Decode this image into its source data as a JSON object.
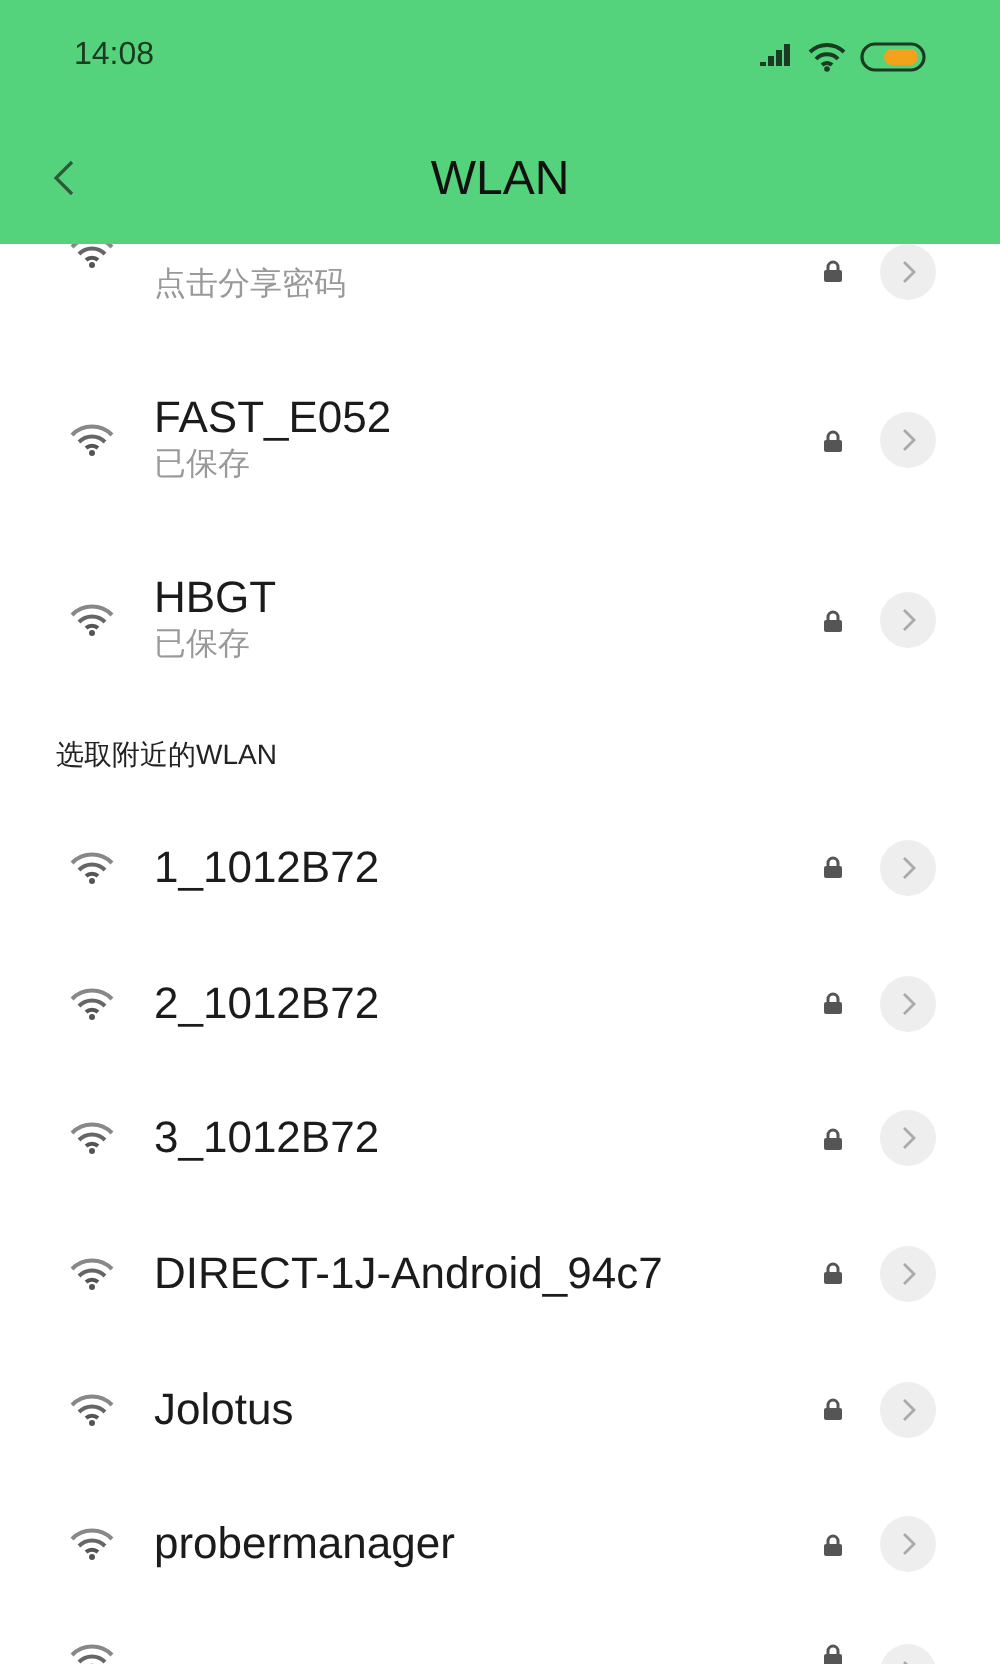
{
  "status_bar": {
    "time": "14:08"
  },
  "header": {
    "title": "WLAN"
  },
  "saved_networks": [
    {
      "subtitle": "点击分享密码",
      "secured": true
    },
    {
      "name": "FAST_E052",
      "subtitle": "已保存",
      "secured": true
    },
    {
      "name": "HBGT",
      "subtitle": "已保存",
      "secured": true
    }
  ],
  "nearby_section": {
    "title": "选取附近的WLAN",
    "networks": [
      {
        "name": "1_1012B72",
        "secured": true
      },
      {
        "name": "2_1012B72",
        "secured": true
      },
      {
        "name": "3_1012B72",
        "secured": true
      },
      {
        "name": "DIRECT-1J-Android_94c7",
        "secured": true
      },
      {
        "name": "Jolotus",
        "secured": true
      },
      {
        "name": "probermanager",
        "secured": true
      },
      {
        "secured": true
      }
    ]
  }
}
